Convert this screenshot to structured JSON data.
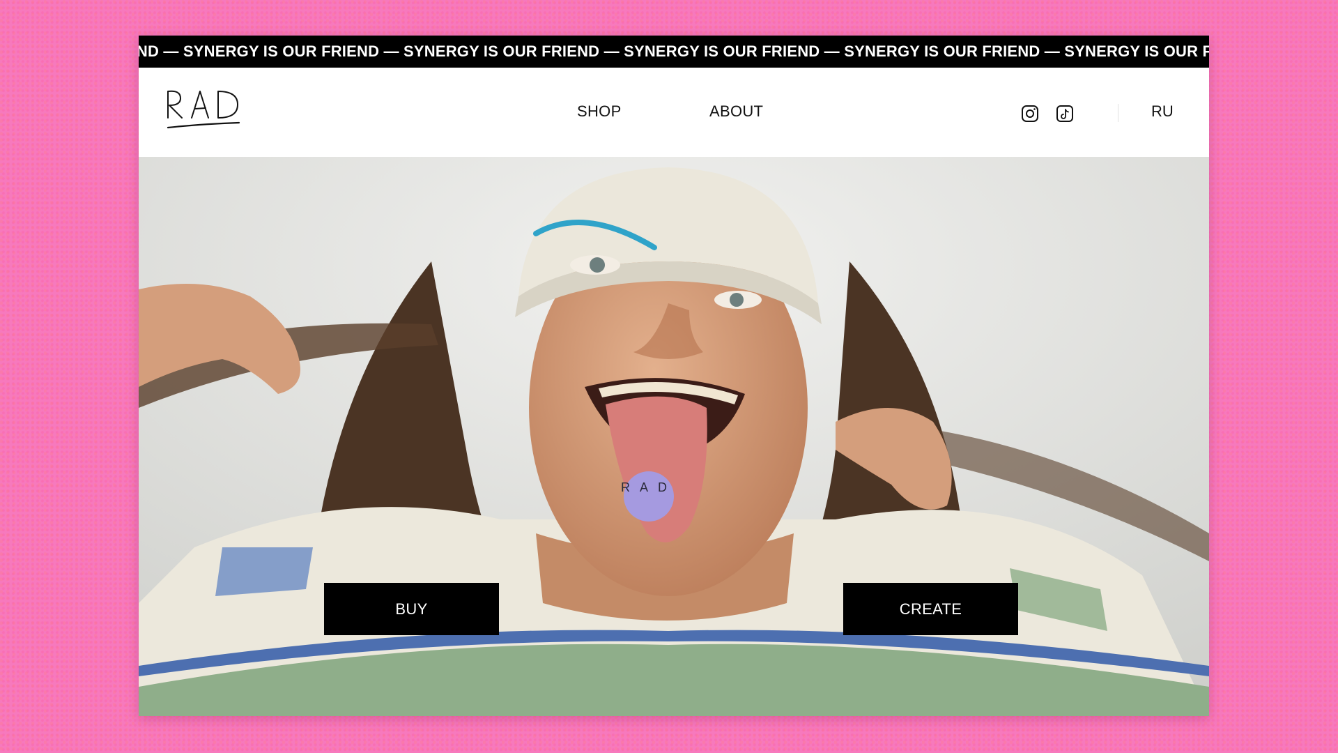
{
  "ticker": {
    "text": "END — SYNERGY IS OUR FRIEND — SYNERGY IS OUR FRIEND — SYNERGY IS OUR FRIEND — SYNERGY IS OUR FRIEND — SYNERGY IS OUR FRIEND — SYNERGY IS OUR FRIEND"
  },
  "header": {
    "logo_text": "RAD",
    "nav": [
      {
        "label": "SHOP"
      },
      {
        "label": "ABOUT"
      }
    ],
    "social": [
      {
        "icon": "instagram-icon"
      },
      {
        "icon": "tiktok-icon"
      }
    ],
    "language": "RU"
  },
  "hero": {
    "pill_text": "RAD",
    "buttons": {
      "buy": "BUY",
      "create": "CREATE"
    }
  },
  "colors": {
    "background": "#f779bd",
    "ticker_bg": "#000000",
    "button_bg": "#000000",
    "pill": "#a59ae0"
  }
}
